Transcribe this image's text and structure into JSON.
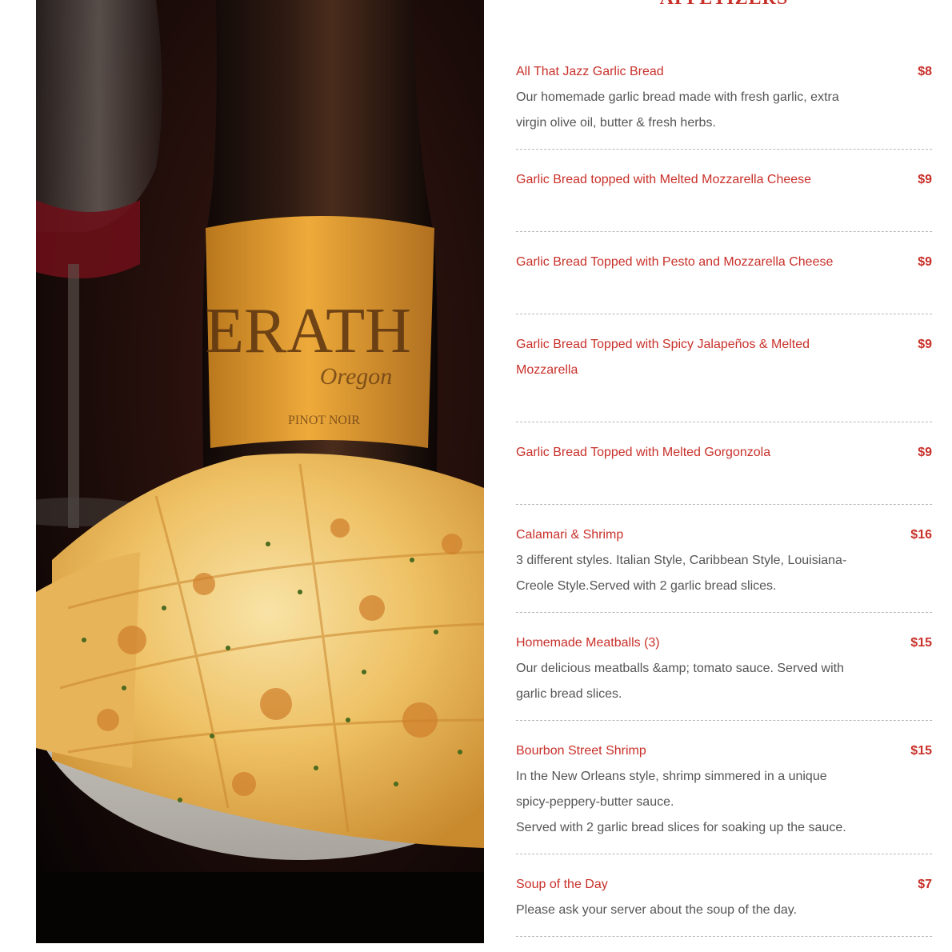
{
  "section": {
    "title": "APPETIZERS"
  },
  "photo": {
    "label_text": "ERATH",
    "label_subtext": "Oregon",
    "label_variety": "PINOT NOIR"
  },
  "items": [
    {
      "name": "All That Jazz Garlic Bread",
      "price": "$8",
      "desc": [
        "Our homemade garlic bread made with fresh garlic, extra virgin olive oil, butter & fresh herbs."
      ]
    },
    {
      "name": "Garlic Bread topped with Melted Mozzarella Cheese",
      "price": "$9",
      "desc": []
    },
    {
      "name": "Garlic Bread Topped with Pesto and Mozzarella Cheese",
      "price": "$9",
      "desc": []
    },
    {
      "name": "Garlic Bread Topped with Spicy Jalapeños & Melted Mozzarella",
      "price": "$9",
      "desc": []
    },
    {
      "name": "Garlic Bread Topped with Melted Gorgonzola",
      "price": "$9",
      "desc": []
    },
    {
      "name": "Calamari & Shrimp",
      "price": "$16",
      "desc": [
        "3 different styles. Italian Style, Caribbean Style, Louisiana-Creole Style.Served with 2 garlic bread slices."
      ]
    },
    {
      "name": "Homemade Meatballs (3)",
      "price": "$15",
      "desc": [
        "Our delicious meatballs &amp; tomato sauce. Served with garlic bread slices."
      ]
    },
    {
      "name": "Bourbon Street Shrimp",
      "price": "$15",
      "desc": [
        "In the New Orleans style, shrimp simmered in a unique spicy-peppery-butter sauce.",
        "Served with 2 garlic bread slices for soaking up the sauce."
      ]
    },
    {
      "name": "Soup of the Day",
      "price": "$7",
      "desc": [
        "Please ask your server about the soup of the day."
      ]
    }
  ]
}
